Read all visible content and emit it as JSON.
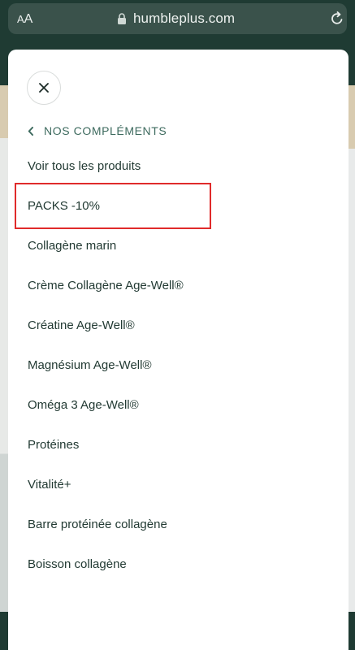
{
  "browser": {
    "text_size_button": "AA",
    "url": "humbleplus.com"
  },
  "menu": {
    "back_label": "NOS COMPLÉMENTS",
    "items": [
      "Voir tous les produits",
      "PACKS -10%",
      "Collagène marin",
      "Crème Collagène Age-Well®",
      "Créatine Age-Well®",
      "Magnésium Age-Well®",
      "Oméga 3 Age-Well®",
      "Protéines",
      "Vitalité+",
      "Barre protéinée collagène",
      "Boisson collagène"
    ],
    "highlighted_item": "PACKS -10%"
  },
  "colors": {
    "brand_dark_green": "#1f3b33",
    "accent_green": "#3d6a5e",
    "highlight_red": "#e02b2b"
  },
  "icons": [
    "lock-icon",
    "reload-icon",
    "close-icon",
    "chevron-left-icon"
  ]
}
